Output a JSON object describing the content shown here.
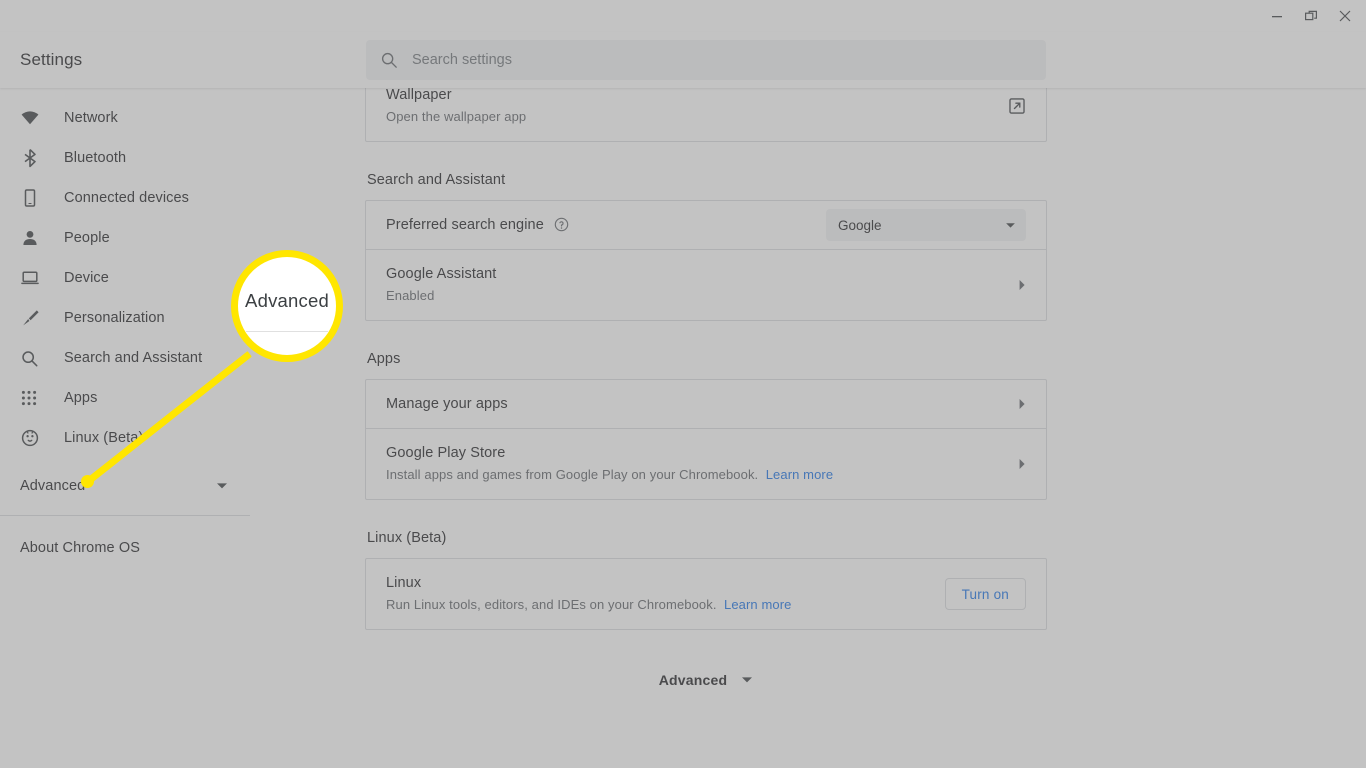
{
  "window": {
    "buttons": [
      {
        "name": "minimize",
        "label": "Minimize"
      },
      {
        "name": "restore",
        "label": "Restore"
      },
      {
        "name": "close",
        "label": "Close"
      }
    ]
  },
  "header": {
    "title": "Settings",
    "search": {
      "placeholder": "Search settings",
      "value": "",
      "icon": "search-icon"
    }
  },
  "sidebar": {
    "items": [
      {
        "label": "Network",
        "icon": "wifi-icon"
      },
      {
        "label": "Bluetooth",
        "icon": "bluetooth-icon"
      },
      {
        "label": "Connected devices",
        "icon": "phone-icon"
      },
      {
        "label": "People",
        "icon": "person-icon"
      },
      {
        "label": "Device",
        "icon": "laptop-icon"
      },
      {
        "label": "Personalization",
        "icon": "brush-icon"
      },
      {
        "label": "Search and Assistant",
        "icon": "search-icon"
      },
      {
        "label": "Apps",
        "icon": "grid-apps-icon"
      },
      {
        "label": "Linux (Beta)",
        "icon": "linux-penguin-icon"
      }
    ],
    "advanced": {
      "label": "Advanced",
      "icon": "chevron-down-icon"
    },
    "about": {
      "label": "About Chrome OS"
    }
  },
  "main": {
    "wallpaper_card": {
      "title": "Wallpaper",
      "subtitle": "Open the wallpaper app",
      "icon": "open-external-icon"
    },
    "sections": [
      {
        "title": "Search and Assistant",
        "rows": [
          {
            "title": "Preferred search engine",
            "help_icon": "help-circle-icon",
            "control": "select",
            "select_value": "Google",
            "select_options": [
              "Google"
            ]
          },
          {
            "title": "Google Assistant",
            "subtitle": "Enabled",
            "control": "arrow",
            "arrow_icon": "chevron-right-icon"
          }
        ]
      },
      {
        "title": "Apps",
        "rows": [
          {
            "title": "Manage your apps",
            "control": "arrow",
            "arrow_icon": "chevron-right-icon"
          },
          {
            "title": "Google Play Store",
            "subtitle": "Install apps and games from Google Play on your Chromebook.",
            "link": "Learn more",
            "control": "arrow",
            "arrow_icon": "chevron-right-icon"
          }
        ]
      },
      {
        "title": "Linux (Beta)",
        "rows": [
          {
            "title": "Linux",
            "subtitle": "Run Linux tools, editors, and IDEs on your Chromebook.",
            "link": "Learn more",
            "control": "button",
            "button_label": "Turn on"
          }
        ]
      }
    ],
    "advanced_expander": {
      "label": "Advanced",
      "icon": "chevron-down-icon"
    }
  },
  "callout": {
    "magnified_label": "Advanced",
    "highlight_color": "#ffe600"
  },
  "colors": {
    "accent_link": "#1a73e8",
    "text_primary": "#202124",
    "text_secondary": "#5f6368",
    "card_border": "#dadce0",
    "highlight": "#ffe600"
  }
}
